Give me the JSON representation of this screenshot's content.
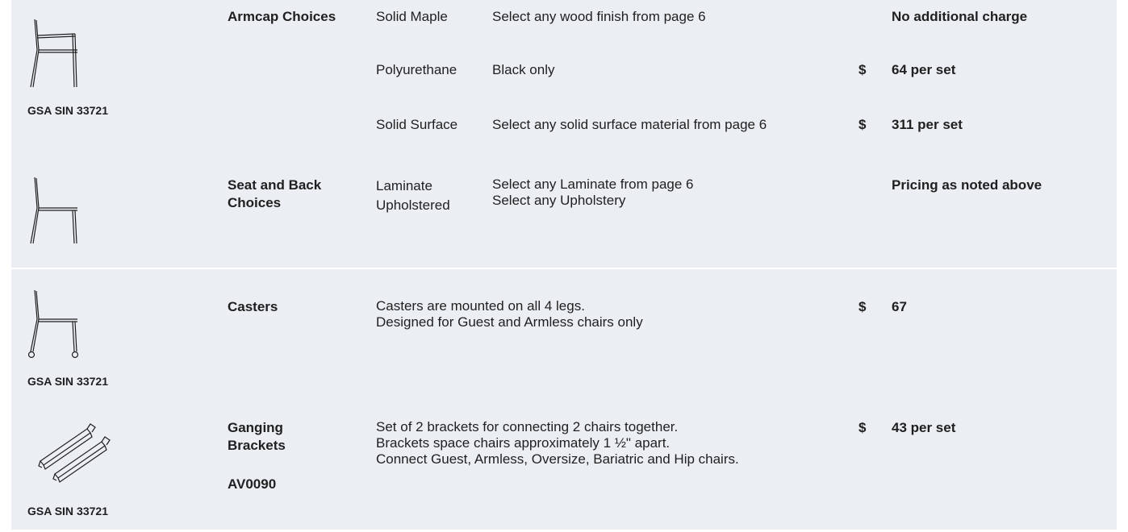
{
  "sections": {
    "armcap": {
      "label": "Armcap Choices",
      "gsa_label": "GSA SIN",
      "gsa_number": "33721",
      "illustration": "armchair-side-illustration",
      "options": [
        {
          "material": "Solid Maple",
          "description": "Select any wood finish from page 6",
          "currency": "",
          "price": "No additional charge"
        },
        {
          "material": "Polyurethane",
          "description": "Black only",
          "currency": "$",
          "price": "64 per set"
        },
        {
          "material": "Solid Surface",
          "description": "Select any solid surface material from page 6",
          "currency": "$",
          "price": "311 per set"
        }
      ]
    },
    "seat_back": {
      "label": "Seat and Back\nChoices",
      "illustration": "armless-chair-side-illustration",
      "materials": "Laminate\nUpholstered",
      "descriptions": "Select any Laminate from page 6\nSelect any Upholstery",
      "price": "Pricing as noted above"
    },
    "casters": {
      "label": "Casters",
      "illustration": "chair-with-casters-illustration",
      "gsa_label": "GSA SIN",
      "gsa_number": "33721",
      "description": "Casters are mounted on all 4 legs.\nDesigned for Guest and Armless chairs only",
      "currency": "$",
      "price": "67"
    },
    "ganging": {
      "label": "Ganging\nBrackets",
      "code": "AV0090",
      "illustration": "ganging-brackets-illustration",
      "gsa_label": "GSA SIN",
      "gsa_number": "33721",
      "description": "Set of 2 brackets for connecting 2 chairs together.\nBrackets space chairs approximately 1 ½\" apart.\nConnect Guest, Armless, Oversize, Bariatric and Hip chairs.",
      "currency": "$",
      "price": "43 per set"
    }
  }
}
